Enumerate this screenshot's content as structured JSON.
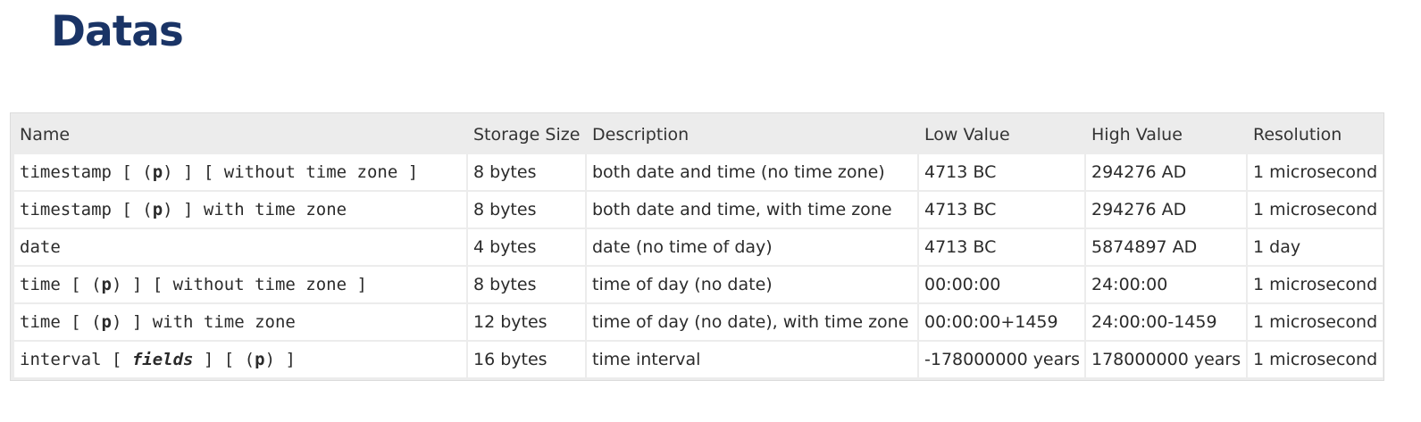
{
  "page": {
    "title": "Datas"
  },
  "table": {
    "headers": [
      "Name",
      "Storage Size",
      "Description",
      "Low Value",
      "High Value",
      "Resolution"
    ],
    "rows": [
      {
        "name_parts": [
          "timestamp [ (",
          "p",
          ") ] [ without time zone ]"
        ],
        "storage": "8 bytes",
        "description": "both date and time (no time zone)",
        "low": "4713 BC",
        "high": "294276 AD",
        "resolution": "1 microsecond"
      },
      {
        "name_parts": [
          "timestamp [ (",
          "p",
          ") ] with time zone"
        ],
        "storage": "8 bytes",
        "description": "both date and time, with time zone",
        "low": "4713 BC",
        "high": "294276 AD",
        "resolution": "1 microsecond"
      },
      {
        "name_parts": [
          "date"
        ],
        "storage": "4 bytes",
        "description": "date (no time of day)",
        "low": "4713 BC",
        "high": "5874897 AD",
        "resolution": "1 day"
      },
      {
        "name_parts": [
          "time [ (",
          "p",
          ") ] [ without time zone ]"
        ],
        "storage": "8 bytes",
        "description": "time of day (no date)",
        "low": "00:00:00",
        "high": "24:00:00",
        "resolution": "1 microsecond"
      },
      {
        "name_parts": [
          "time [ (",
          "p",
          ") ] with time zone"
        ],
        "storage": "12 bytes",
        "description": "time of day (no date), with time zone",
        "low": "00:00:00+1459",
        "high": "24:00:00-1459",
        "resolution": "1 microsecond"
      },
      {
        "name_parts": [
          "interval [ ",
          "fields",
          " ] [ (",
          "p",
          ") ]"
        ],
        "storage": "16 bytes",
        "description": "time interval",
        "low": "-178000000 years",
        "high": "178000000 years",
        "resolution": "1 microsecond"
      }
    ]
  }
}
